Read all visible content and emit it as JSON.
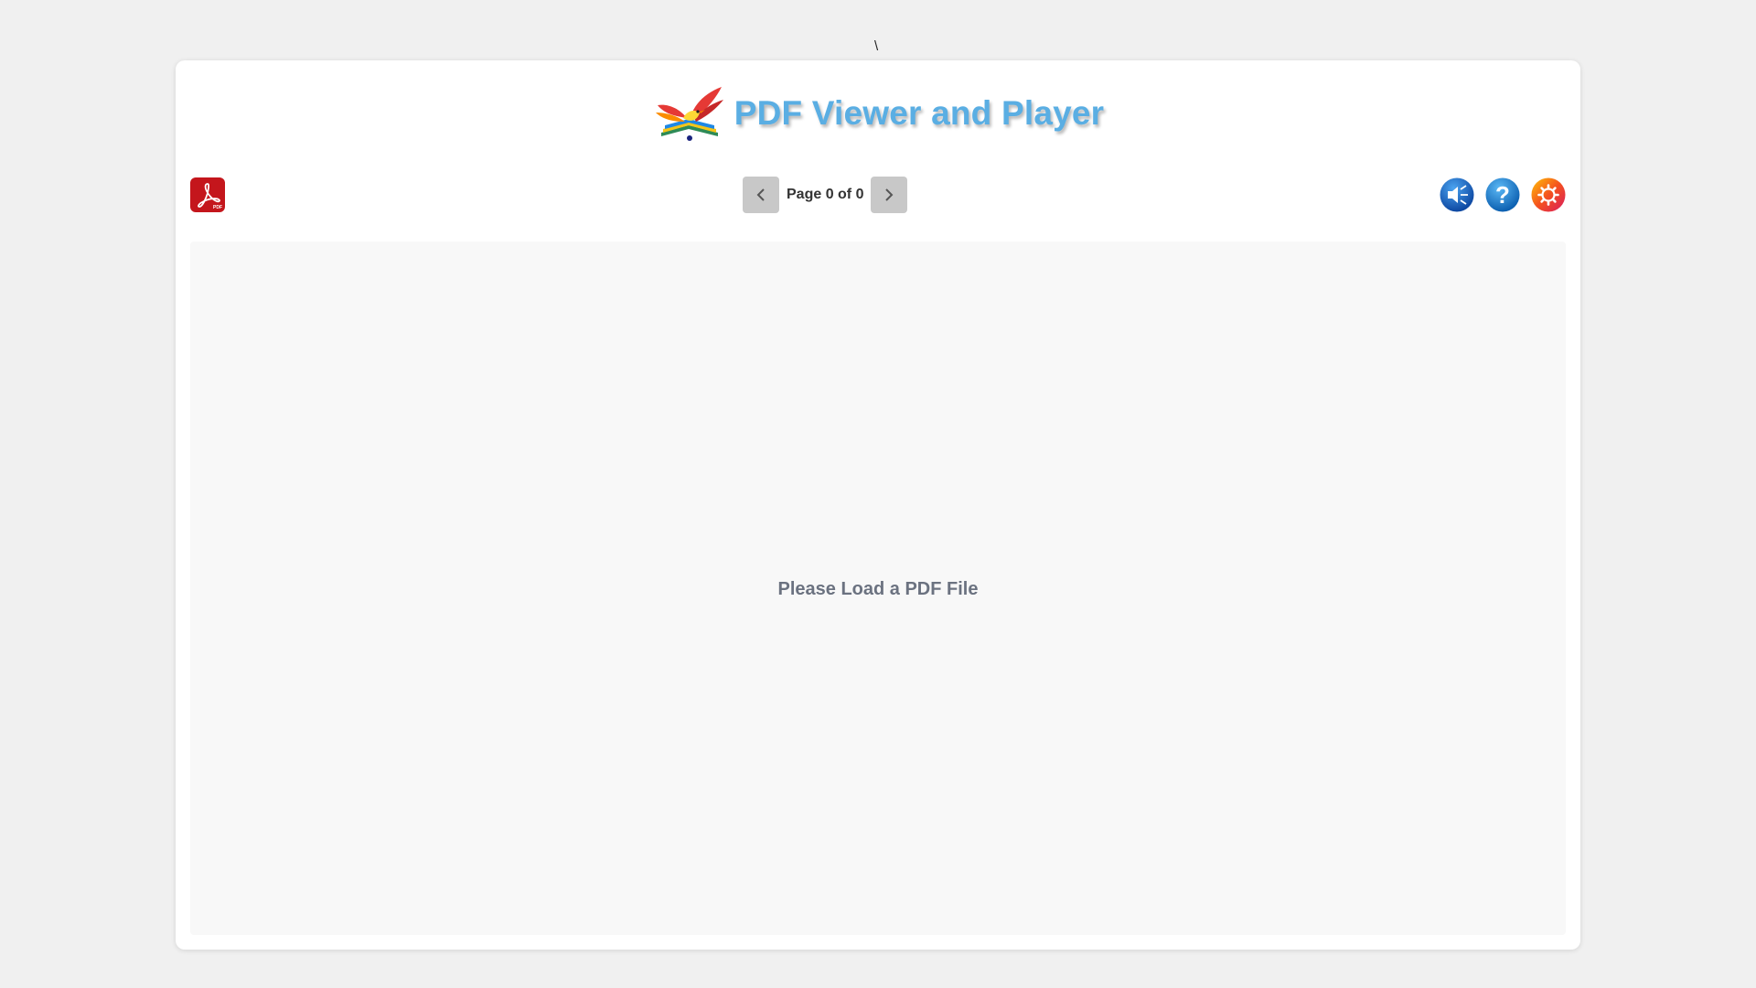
{
  "stray_mark": "\\",
  "header": {
    "title": "PDF Viewer and Player",
    "logo_icon": "bird-book-logo-icon"
  },
  "toolbar": {
    "load_pdf_icon": "pdf-file-icon",
    "prev_icon": "chevron-left-icon",
    "next_icon": "chevron-right-icon",
    "page_indicator": "Page 0 of 0",
    "audio_icon": "speaker-icon",
    "help_icon": "question-mark-icon",
    "settings_icon": "gear-icon"
  },
  "viewer": {
    "placeholder": "Please Load a PDF File"
  },
  "colors": {
    "title": "#5aaee3",
    "pdf_red": "#c4161c",
    "audio_blue": "#1565c0",
    "help_blue": "#1e7fd6",
    "settings_orange": "#f5a300",
    "background": "#f0f0f0"
  }
}
